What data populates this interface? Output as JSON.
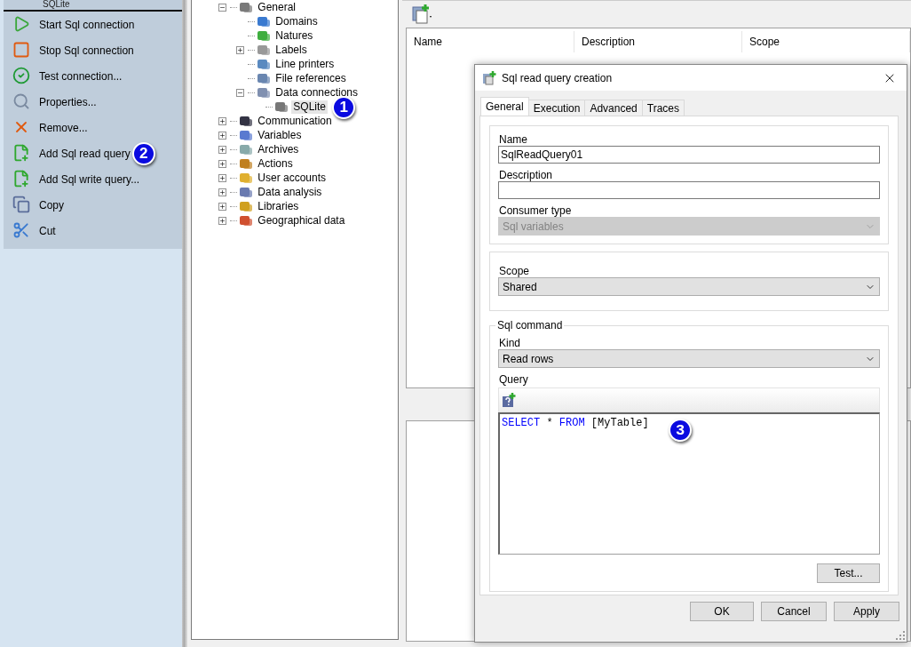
{
  "actions_panel": {
    "header": "SQLite",
    "items": [
      {
        "label": "Start Sql connection"
      },
      {
        "label": "Stop Sql connection"
      },
      {
        "label": "Test connection..."
      },
      {
        "label": "Properties..."
      },
      {
        "label": "Remove..."
      },
      {
        "label": "Add Sql read query",
        "badge": "2"
      },
      {
        "label": "Add Sql write query..."
      },
      {
        "label": "Copy"
      },
      {
        "label": "Cut"
      }
    ]
  },
  "tree": [
    {
      "label": "General",
      "expanded": true,
      "children": [
        {
          "label": "Domains"
        },
        {
          "label": "Natures"
        },
        {
          "label": "Labels",
          "expanded": false
        },
        {
          "label": "Line printers"
        },
        {
          "label": "File references"
        },
        {
          "label": "Data connections",
          "expanded": true,
          "children": [
            {
              "label": "SQLite",
              "selected": true,
              "badge": "1"
            }
          ]
        }
      ]
    },
    {
      "label": "Communication",
      "expanded": false
    },
    {
      "label": "Variables",
      "expanded": false
    },
    {
      "label": "Archives",
      "expanded": false
    },
    {
      "label": "Actions",
      "expanded": false
    },
    {
      "label": "User accounts",
      "expanded": false
    },
    {
      "label": "Data analysis",
      "expanded": false
    },
    {
      "label": "Libraries",
      "expanded": false
    },
    {
      "label": "Geographical data",
      "expanded": false
    }
  ],
  "list": {
    "columns": [
      "Name",
      "Description",
      "Scope"
    ]
  },
  "dialog": {
    "title": "Sql read query creation",
    "tabs": [
      {
        "label": "General",
        "selected": true
      },
      {
        "label": "Execution",
        "selected": false
      },
      {
        "label": "Advanced",
        "selected": false
      },
      {
        "label": "Traces",
        "selected": false
      }
    ],
    "name": {
      "label": "Name",
      "value": "SqlReadQuery01"
    },
    "description": {
      "label": "Description"
    },
    "consumer_type": {
      "label": "Consumer type",
      "value": "Sql variables",
      "disabled": true
    },
    "scope": {
      "label": "Scope",
      "value": "Shared",
      "disabled": false
    },
    "sql_command": {
      "legend": "Sql command",
      "kind": {
        "label": "Kind",
        "value": "Read rows",
        "disabled": false
      },
      "query_label": "Query",
      "code": [
        {
          "text": "SELECT",
          "kind": "keyword"
        },
        {
          "text": " * ",
          "kind": "plain"
        },
        {
          "text": "FROM",
          "kind": "keyword"
        },
        {
          "text": " [MyTable]",
          "kind": "plain"
        }
      ],
      "badge": "3",
      "test_button": "Test..."
    },
    "buttons": [
      "OK",
      "Cancel",
      "Apply"
    ]
  }
}
